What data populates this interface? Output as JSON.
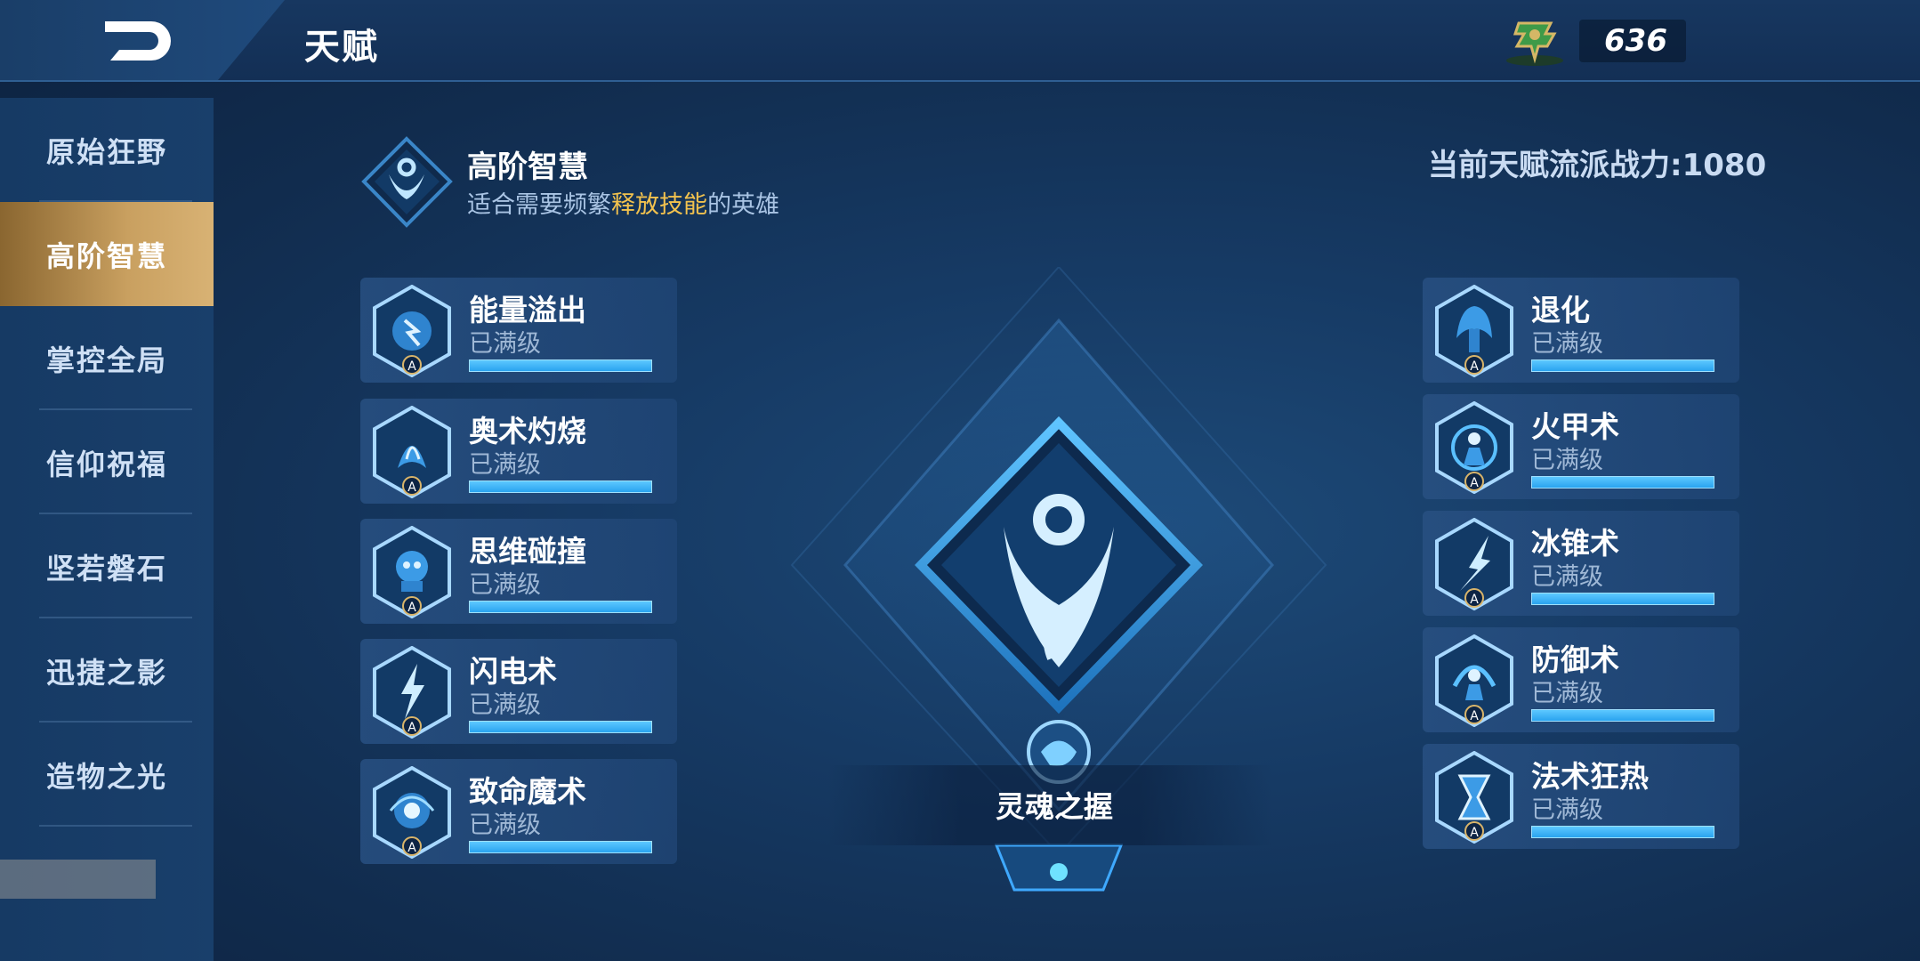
{
  "header": {
    "title": "天赋",
    "currency_value": "636"
  },
  "sidebar": {
    "items": [
      {
        "label": "原始狂野"
      },
      {
        "label": "高阶智慧",
        "active": true
      },
      {
        "label": "掌控全局"
      },
      {
        "label": "信仰祝福"
      },
      {
        "label": "坚若磐石"
      },
      {
        "label": "迅捷之影"
      },
      {
        "label": "造物之光"
      }
    ]
  },
  "school": {
    "name": "高阶智慧",
    "desc_prefix": "适合需要频繁",
    "desc_highlight": "释放技能",
    "desc_suffix": "的英雄",
    "power_label": "当前天赋流派战力:1080"
  },
  "talents_left": [
    {
      "name": "能量溢出",
      "status": "已满级",
      "progress": 1.0
    },
    {
      "name": "奥术灼烧",
      "status": "已满级",
      "progress": 1.0
    },
    {
      "name": "思维碰撞",
      "status": "已满级",
      "progress": 1.0
    },
    {
      "name": "闪电术",
      "status": "已满级",
      "progress": 1.0
    },
    {
      "name": "致命魔术",
      "status": "已满级",
      "progress": 1.0
    }
  ],
  "talents_right": [
    {
      "name": "退化",
      "status": "已满级",
      "progress": 1.0
    },
    {
      "name": "火甲术",
      "status": "已满级",
      "progress": 1.0
    },
    {
      "name": "冰锥术",
      "status": "已满级",
      "progress": 1.0
    },
    {
      "name": "防御术",
      "status": "已满级",
      "progress": 1.0
    },
    {
      "name": "法术狂热",
      "status": "已满级",
      "progress": 1.0
    }
  ],
  "core_talent": {
    "name": "灵魂之握"
  },
  "icon_badge": "A",
  "colors": {
    "accent_gold": "#f2c24e",
    "progress_blue": "#2aa3ef",
    "active_tab": "#c9a060"
  }
}
